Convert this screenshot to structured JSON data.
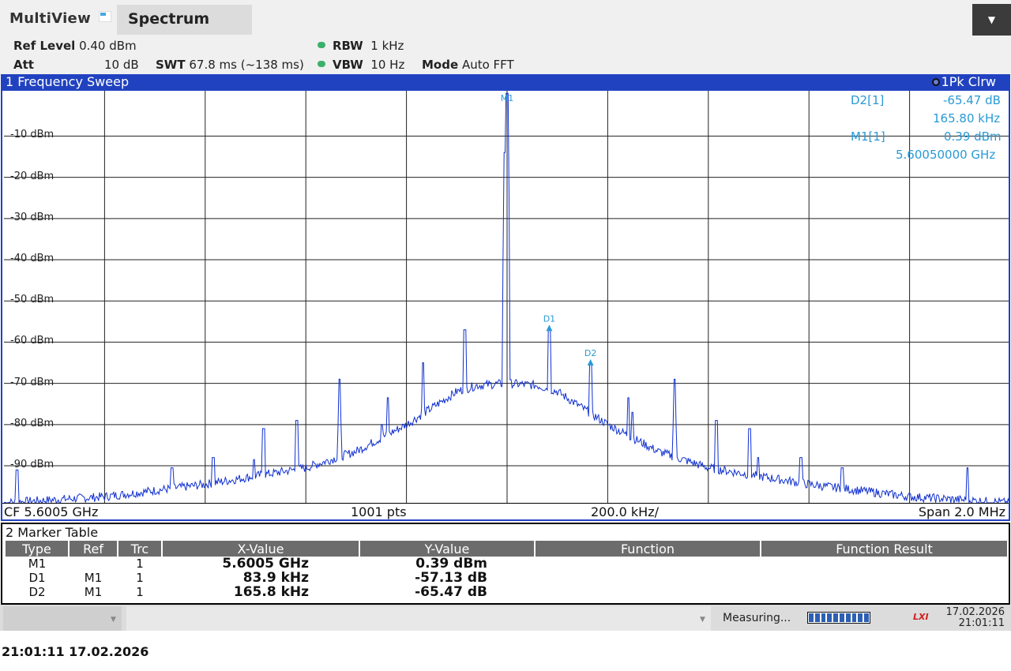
{
  "header": {
    "app_title": "MultiView",
    "tab_label": "Spectrum"
  },
  "settings": {
    "ref_level_label": "Ref Level",
    "ref_level_value": "0.40 dBm",
    "att_label": "Att",
    "att_value": "10 dB",
    "swt_label": "SWT",
    "swt_value": "67.8 ms (~138 ms)",
    "rbw_label": "RBW",
    "rbw_value": "1 kHz",
    "vbw_label": "VBW",
    "vbw_value": "10 Hz",
    "mode_label": "Mode",
    "mode_value": "Auto FFT"
  },
  "sweep_panel": {
    "title": "1 Frequency Sweep",
    "trace_indicator": "1Pk Clrw",
    "footer": {
      "cf": "CF 5.6005 GHz",
      "points": "1001 pts",
      "div": "200.0 kHz/",
      "span": "Span 2.0 MHz"
    }
  },
  "marker_readout": {
    "d2_label": "D2[1]",
    "d2_level": "-65.47 dB",
    "d2_freq": "165.80 kHz",
    "m1_label": "M1[1]",
    "m1_level": "0.39 dBm",
    "m1_freq": "5.60050000 GHz"
  },
  "marker_labels": {
    "m1": "M1",
    "d1": "D1",
    "d2": "D2"
  },
  "chart_data": {
    "type": "line",
    "x_unit": "kHz offset from CF 5.6005 GHz",
    "xlim": [
      -1000,
      1000
    ],
    "ylim": [
      -99,
      1
    ],
    "grid": true,
    "yticks": [
      "-10 dBm",
      "-20 dBm",
      "-30 dBm",
      "-40 dBm",
      "-50 dBm",
      "-60 dBm",
      "-70 dBm",
      "-80 dBm",
      "-90 dBm"
    ],
    "ytick_values": [
      -10,
      -20,
      -30,
      -40,
      -50,
      -60,
      -70,
      -80,
      -90
    ],
    "trace_color": "#1030d0",
    "marker_color": "#2a9ad6",
    "noise_floor": [
      [
        -1000,
        -99
      ],
      [
        -800,
        -97.5
      ],
      [
        -600,
        -94.5
      ],
      [
        -400,
        -90.5
      ],
      [
        -300,
        -86.5
      ],
      [
        -200,
        -80
      ],
      [
        -150,
        -76
      ],
      [
        -100,
        -72
      ],
      [
        -60,
        -70.5
      ],
      [
        0,
        -70
      ],
      [
        60,
        -70.5
      ],
      [
        100,
        -72
      ],
      [
        150,
        -76
      ],
      [
        200,
        -80
      ],
      [
        300,
        -86.5
      ],
      [
        400,
        -90.5
      ],
      [
        600,
        -94.5
      ],
      [
        800,
        -97.5
      ],
      [
        1000,
        -99
      ]
    ],
    "spurs": [
      {
        "x": -974,
        "y": -91
      },
      {
        "x": -666,
        "y": -90.5
      },
      {
        "x": -584,
        "y": -88
      },
      {
        "x": -503,
        "y": -88.5
      },
      {
        "x": -484,
        "y": -81
      },
      {
        "x": -418,
        "y": -79
      },
      {
        "x": -333,
        "y": -69
      },
      {
        "x": -249,
        "y": -80
      },
      {
        "x": -237,
        "y": -73.5
      },
      {
        "x": -167,
        "y": -65
      },
      {
        "x": -84,
        "y": -57
      },
      {
        "x": -4,
        "y": -14
      },
      {
        "x": 0,
        "y": 0.39
      },
      {
        "x": 84,
        "y": -57
      },
      {
        "x": 166,
        "y": -65.5
      },
      {
        "x": 241,
        "y": -73.5
      },
      {
        "x": 249,
        "y": -77
      },
      {
        "x": 333,
        "y": -69
      },
      {
        "x": 416,
        "y": -79
      },
      {
        "x": 482,
        "y": -81
      },
      {
        "x": 499,
        "y": -88
      },
      {
        "x": 584,
        "y": -88
      },
      {
        "x": 666,
        "y": -90.5
      },
      {
        "x": 915,
        "y": -90.5
      }
    ],
    "markers": [
      {
        "name": "M1",
        "x": 0,
        "y": 0.39
      },
      {
        "name": "D1",
        "x": 83.9,
        "y": -56.74
      },
      {
        "name": "D2",
        "x": 165.8,
        "y": -65.08
      }
    ]
  },
  "marker_table": {
    "title": "2 Marker Table",
    "headers": [
      "Type",
      "Ref",
      "Trc",
      "X-Value",
      "Y-Value",
      "Function",
      "Function Result"
    ],
    "rows": [
      {
        "type": "M1",
        "ref": "",
        "trc": "1",
        "x": "5.6005 GHz",
        "y": "0.39 dBm"
      },
      {
        "type": "D1",
        "ref": "M1",
        "trc": "1",
        "x": "83.9 kHz",
        "y": "-57.13 dB"
      },
      {
        "type": "D2",
        "ref": "M1",
        "trc": "1",
        "x": "165.8 kHz",
        "y": "-65.47 dB"
      }
    ]
  },
  "statusbar": {
    "measuring": "Measuring...",
    "lxi": "LXI",
    "date": "17.02.2026",
    "time": "21:01:11"
  },
  "bottom_timestamp": "21:01:11  17.02.2026"
}
